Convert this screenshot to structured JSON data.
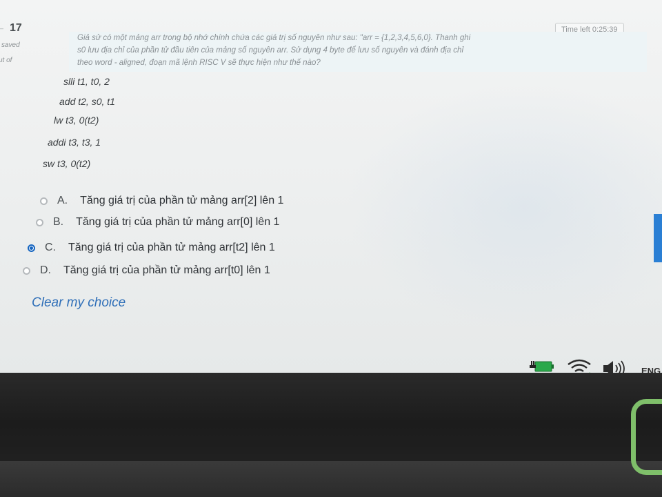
{
  "question": {
    "number": "17",
    "status": "saved",
    "mark": "ut of",
    "timer_label": "Time left 0:25:39",
    "prompt_lines": [
      "Giả sử có một mảng arr trong bộ nhớ chính chứa các giá trị số nguyên như sau: \"arr = {1,2,3,4,5,6,0}. Thanh ghi",
      "s0 lưu địa chỉ của phần tử đầu tiên của mảng số nguyên arr. Sử dụng 4 byte để lưu số nguyên và đánh địa chỉ",
      "theo word - aligned, đoạn mã lệnh RISC V sẽ thực hiện như thế nào?"
    ],
    "code_lines": [
      "slli t1, t0, 2",
      "add t2, s0, t1",
      "lw t3, 0(t2)",
      "addi t3, t3, 1",
      "sw t3, 0(t2)"
    ]
  },
  "options": [
    {
      "letter": "A.",
      "text": "Tăng giá trị của phần tử mảng arr[2] lên 1",
      "selected": false
    },
    {
      "letter": "B.",
      "text": "Tăng giá trị của phần tử mảng arr[0] lên 1",
      "selected": false
    },
    {
      "letter": "C.",
      "text": "Tăng giá trị của phần tử mảng arr[t2] lên 1",
      "selected": true
    },
    {
      "letter": "D.",
      "text": "Tăng giá trị của phần tử mảng arr[t0] lên 1",
      "selected": false
    }
  ],
  "clear_choice_label": "Clear my choice",
  "taskbar": {
    "language": "ENG",
    "icons": [
      "battery-charging-icon",
      "wifi-icon",
      "speaker-icon"
    ]
  },
  "colors": {
    "accent": "#1565c0",
    "link": "#2f6fb8",
    "battery": "#2aa84a"
  }
}
